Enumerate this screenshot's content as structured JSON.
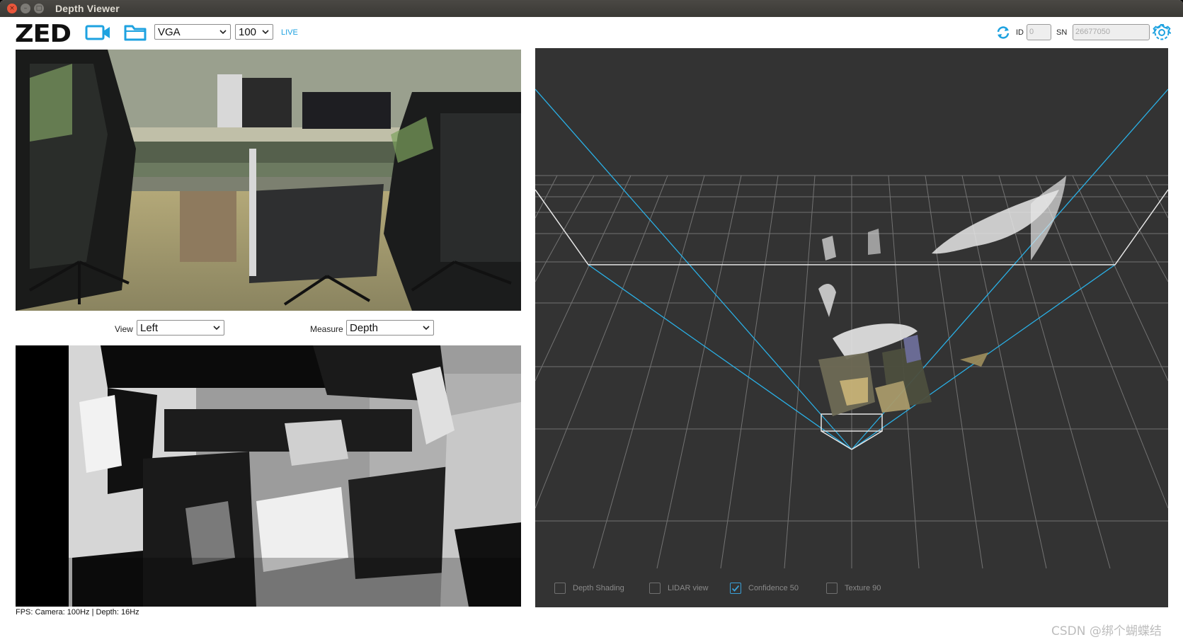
{
  "window": {
    "title": "Depth Viewer",
    "controls": {
      "close": "×",
      "minimize": "–",
      "maximize": "□"
    }
  },
  "toolbar": {
    "logo": "ZED",
    "camera_icon": "video-camera-icon",
    "folder_icon": "folder-icon",
    "resolution": "VGA",
    "fps": "100",
    "live_label": "LIVE",
    "refresh_icon": "refresh-icon",
    "id_label": "ID",
    "id_value": "0",
    "sn_label": "SN",
    "sn_value": "26677050",
    "settings_icon": "gear-icon",
    "accent_color": "#1ea2e0"
  },
  "left_panel": {
    "view_label": "View",
    "view_value": "Left",
    "measure_label": "Measure",
    "measure_value": "Depth",
    "status": "FPS: Camera: 100Hz | Depth: 16Hz"
  },
  "pointcloud": {
    "background": "#333333",
    "options": [
      {
        "label": "Depth Shading",
        "checked": false
      },
      {
        "label": "LIDAR view",
        "checked": false
      },
      {
        "label": "Confidence 50",
        "checked": true
      },
      {
        "label": "Texture 90",
        "checked": false
      }
    ]
  },
  "watermark": "CSDN @绑个蝴蝶结"
}
